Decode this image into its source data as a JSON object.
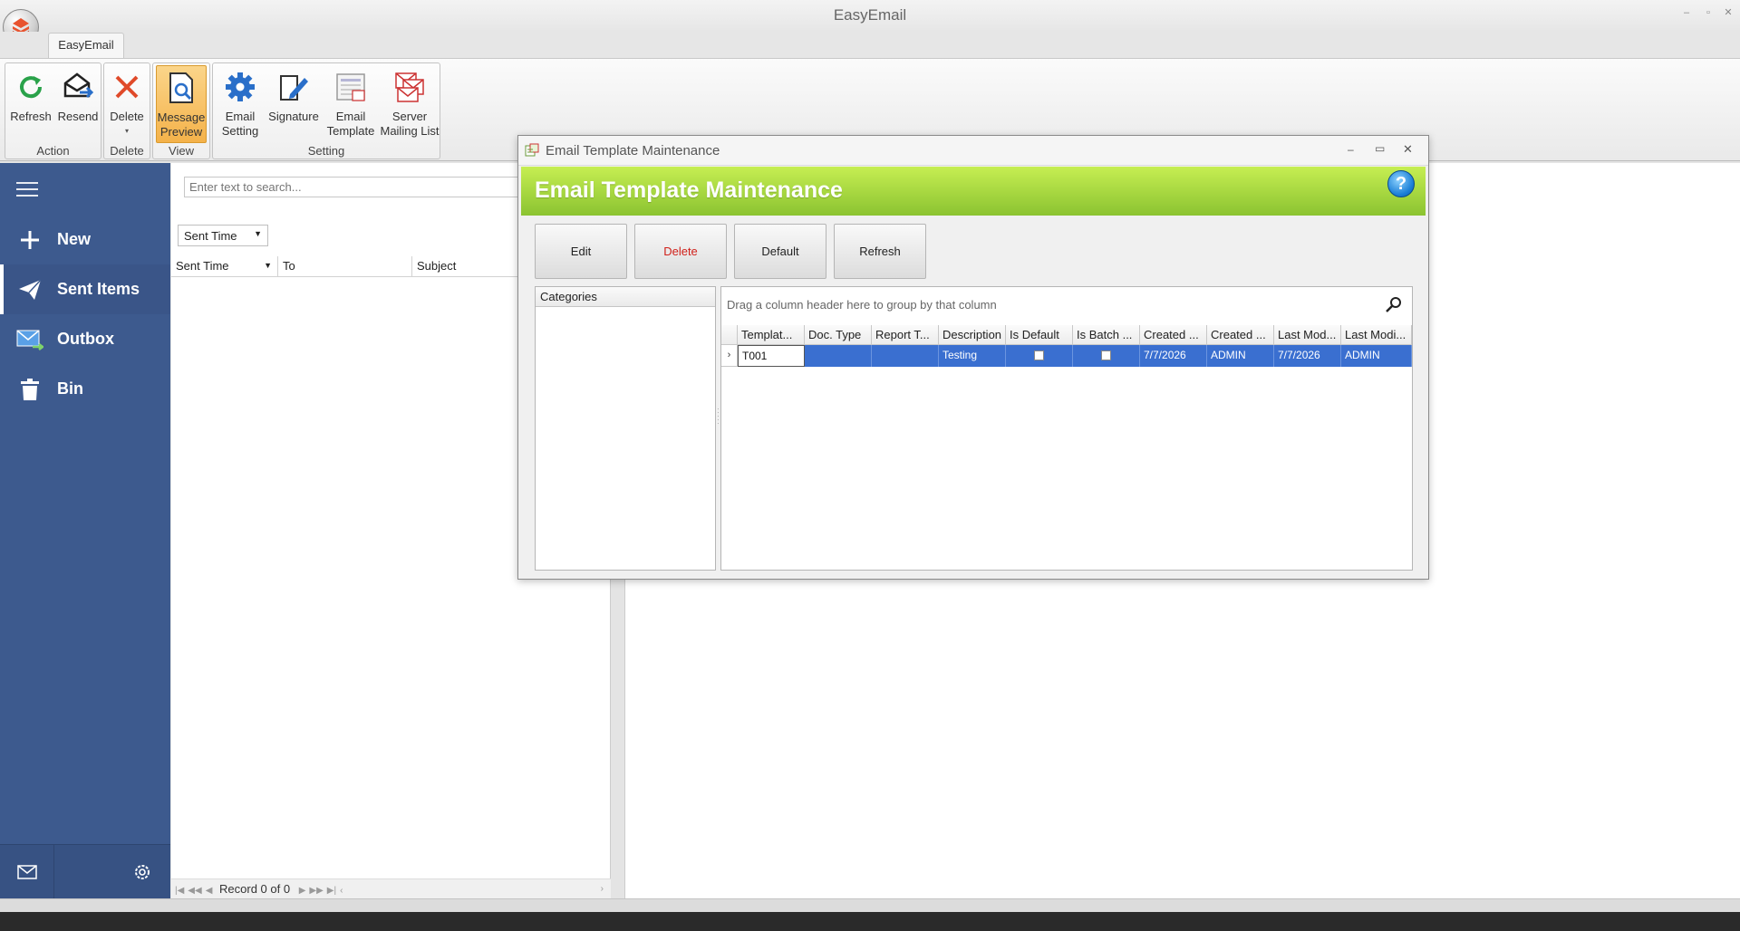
{
  "app": {
    "title": "EasyEmail",
    "tab": "EasyEmail"
  },
  "ribbon": {
    "buttons": {
      "refresh": "Refresh",
      "resend": "Resend",
      "delete": "Delete",
      "message_preview_1": "Message",
      "message_preview_2": "Preview",
      "email_setting_1": "Email",
      "email_setting_2": "Setting",
      "signature": "Signature",
      "email_template_1": "Email",
      "email_template_2": "Template",
      "server_mailing_1": "Server",
      "server_mailing_2": "Mailing List"
    },
    "groups": {
      "action": "Action",
      "delete": "Delete",
      "view": "View",
      "setting": "Setting"
    }
  },
  "sidebar": {
    "items": [
      {
        "label": "New",
        "icon": "plus-icon"
      },
      {
        "label": "Sent Items",
        "icon": "paper-plane-icon"
      },
      {
        "label": "Outbox",
        "icon": "outbox-icon"
      },
      {
        "label": "Bin",
        "icon": "trash-icon"
      }
    ],
    "selected": "Sent Items"
  },
  "list": {
    "search_placeholder": "Enter text to search...",
    "sort_by": "Sent Time",
    "columns": [
      "Sent Time",
      "To",
      "Subject"
    ],
    "pager": "Record 0 of 0"
  },
  "dialog": {
    "window_title": "Email Template Maintenance",
    "heading": "Email Template Maintenance",
    "buttons": {
      "edit": "Edit",
      "delete": "Delete",
      "default": "Default",
      "refresh": "Refresh"
    },
    "categories_header": "Categories",
    "group_hint": "Drag a column header here to group by that column",
    "columns": [
      "Templat...",
      "Doc. Type",
      "Report T...",
      "Description",
      "Is Default",
      "Is Batch ...",
      "Created ...",
      "Created ...",
      "Last Mod...",
      "Last Modi..."
    ],
    "rows": [
      {
        "template": "T001",
        "doc_type": "",
        "report_type": "",
        "description": "Testing",
        "is_default": false,
        "is_batch": false,
        "created_date": "7/7/2026",
        "created_by": "ADMIN",
        "last_modified_date": "7/7/2026",
        "last_modified_by": "ADMIN"
      }
    ]
  },
  "colors": {
    "sidebar": "#3d5a8e",
    "banner": "#9acd3a",
    "selection": "#3a6fd0",
    "active_ribbon": "#f4b24a"
  }
}
